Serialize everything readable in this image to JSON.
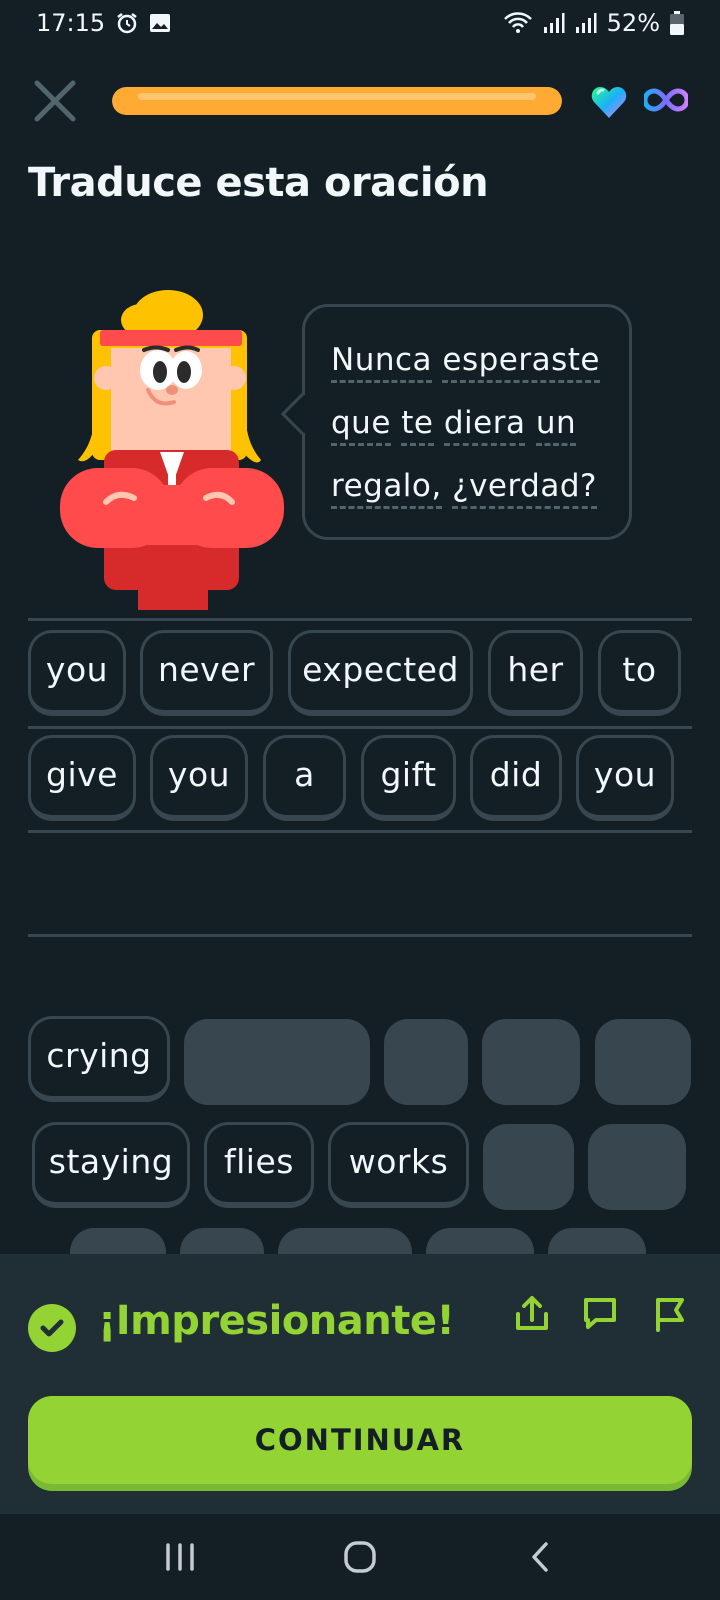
{
  "status_bar": {
    "time": "17:15",
    "battery": "52%"
  },
  "header": {
    "progress": 1.0,
    "accent_color": "#ffab33"
  },
  "exercise": {
    "title": "Traduce esta oración",
    "prompt_lines": [
      [
        "Nunca",
        "esperaste"
      ],
      [
        "que",
        "te",
        "diera",
        "un"
      ],
      [
        "regalo,",
        "¿verdad?"
      ]
    ]
  },
  "answer": {
    "row1": [
      "you",
      "never",
      "expected",
      "her",
      "to"
    ],
    "row2": [
      "give",
      "you",
      "a",
      "gift",
      "did",
      "you"
    ]
  },
  "word_bank": {
    "row1": [
      "crying"
    ],
    "row2": [
      "staying",
      "flies",
      "works"
    ]
  },
  "feedback": {
    "message": "¡Impresionante!",
    "color": "#93d333",
    "continue_label": "CONTINUAR"
  },
  "icons": {
    "close": "close-icon",
    "hearts": "heart-icon",
    "infinity": "infinity-icon",
    "share": "share-icon",
    "comment": "comment-icon",
    "report": "flag-icon"
  }
}
